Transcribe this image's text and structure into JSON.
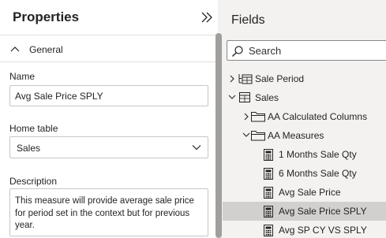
{
  "properties": {
    "title": "Properties",
    "section_general": "General",
    "name_label": "Name",
    "name_value": "Avg Sale Price SPLY",
    "home_table_label": "Home table",
    "home_table_value": "Sales",
    "description_label": "Description",
    "description_value": "This measure will provide average sale price for period set in the context but for previous year."
  },
  "fields": {
    "title": "Fields",
    "search_placeholder": "Search",
    "tree": [
      {
        "label": "Sale Period",
        "icon": "hierarchy-table-icon",
        "expander": "collapsed"
      },
      {
        "label": "Sales",
        "icon": "table-icon",
        "expander": "expanded"
      },
      {
        "label": "AA Calculated Columns",
        "icon": "folder-icon",
        "expander": "collapsed"
      },
      {
        "label": "AA Measures",
        "icon": "folder-icon",
        "expander": "expanded"
      },
      {
        "label": "1 Months Sale Qty",
        "icon": "calculator-icon"
      },
      {
        "label": "6 Months Sale Qty",
        "icon": "calculator-icon"
      },
      {
        "label": "Avg Sale Price",
        "icon": "calculator-icon"
      },
      {
        "label": "Avg Sale Price SPLY",
        "icon": "calculator-icon",
        "selected": true
      },
      {
        "label": "Avg SP CY VS SPLY",
        "icon": "calculator-icon"
      }
    ]
  }
}
